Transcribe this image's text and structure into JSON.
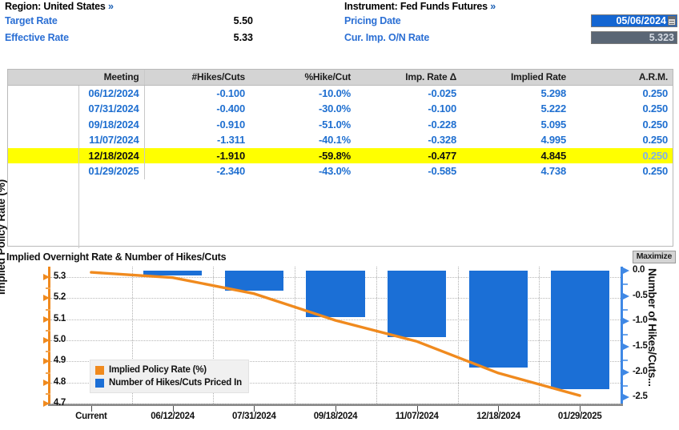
{
  "header": {
    "region_title": "Region: United States",
    "instrument_title": "Instrument: Fed Funds Futures",
    "chevron": "»",
    "target_rate_label": "Target Rate",
    "target_rate_value": "5.50",
    "effective_rate_label": "Effective Rate",
    "effective_rate_value": "5.33",
    "pricing_date_label": "Pricing Date",
    "pricing_date_value": "05/06/2024",
    "cur_imp_on_rate_label": "Cur. Imp. O/N Rate",
    "cur_imp_on_rate_value": "5.323"
  },
  "table": {
    "columns": [
      "",
      "Meeting",
      "#Hikes/Cuts",
      "%Hike/Cut",
      "Imp. Rate Δ",
      "Implied Rate",
      "A.R.M."
    ],
    "rows": [
      {
        "meeting": "06/12/2024",
        "hikes_cuts": "-0.100",
        "pct_hike_cut": "-10.0%",
        "imp_rate_delta": "-0.025",
        "implied_rate": "5.298",
        "arm": "0.250",
        "highlighted": false
      },
      {
        "meeting": "07/31/2024",
        "hikes_cuts": "-0.400",
        "pct_hike_cut": "-30.0%",
        "imp_rate_delta": "-0.100",
        "implied_rate": "5.222",
        "arm": "0.250",
        "highlighted": false
      },
      {
        "meeting": "09/18/2024",
        "hikes_cuts": "-0.910",
        "pct_hike_cut": "-51.0%",
        "imp_rate_delta": "-0.228",
        "implied_rate": "5.095",
        "arm": "0.250",
        "highlighted": false
      },
      {
        "meeting": "11/07/2024",
        "hikes_cuts": "-1.311",
        "pct_hike_cut": "-40.1%",
        "imp_rate_delta": "-0.328",
        "implied_rate": "4.995",
        "arm": "0.250",
        "highlighted": false
      },
      {
        "meeting": "12/18/2024",
        "hikes_cuts": "-1.910",
        "pct_hike_cut": "-59.8%",
        "imp_rate_delta": "-0.477",
        "implied_rate": "4.845",
        "arm": "0.250",
        "highlighted": true
      },
      {
        "meeting": "01/29/2025",
        "hikes_cuts": "-2.340",
        "pct_hike_cut": "-43.0%",
        "imp_rate_delta": "-0.585",
        "implied_rate": "4.738",
        "arm": "0.250",
        "highlighted": false
      }
    ]
  },
  "chart_panel": {
    "title": "Implied Overnight Rate & Number of Hikes/Cuts",
    "maximize_label": "Maximize"
  },
  "chart_data": {
    "type": "bar",
    "title": "Implied Overnight Rate & Number of Hikes/Cuts",
    "xlabel": "",
    "categories": [
      "Current",
      "06/12/2024",
      "07/31/2024",
      "09/18/2024",
      "11/07/2024",
      "12/18/2024",
      "01/29/2025"
    ],
    "left_axis": {
      "label": "Implied Policy Rate (%)",
      "ticks": [
        "5.3",
        "5.2",
        "5.1",
        "5.0",
        "4.9",
        "4.8",
        "4.7"
      ],
      "min": 4.7,
      "max": 5.35,
      "color": "#f08a1e"
    },
    "right_axis": {
      "label": "Number of Hikes/Cuts...",
      "ticks": [
        "0.0",
        "-0.5",
        "-1.0",
        "-1.5",
        "-2.0",
        "-2.5"
      ],
      "min": -2.62,
      "max": 0.08,
      "color": "#3f88e5"
    },
    "grid": true,
    "legend_position": "inside-bottom-left",
    "series": [
      {
        "name": "Implied Policy Rate (%)",
        "type": "line",
        "color": "#f08a1e",
        "axis": "left",
        "values": [
          5.323,
          5.298,
          5.222,
          5.095,
          4.995,
          4.845,
          4.738
        ]
      },
      {
        "name": "Number of Hikes/Cuts Priced In",
        "type": "bar",
        "color": "#1b6fd6",
        "axis": "right",
        "values": [
          0,
          -0.1,
          -0.4,
          -0.91,
          -1.311,
          -1.91,
          -2.34
        ]
      }
    ]
  }
}
